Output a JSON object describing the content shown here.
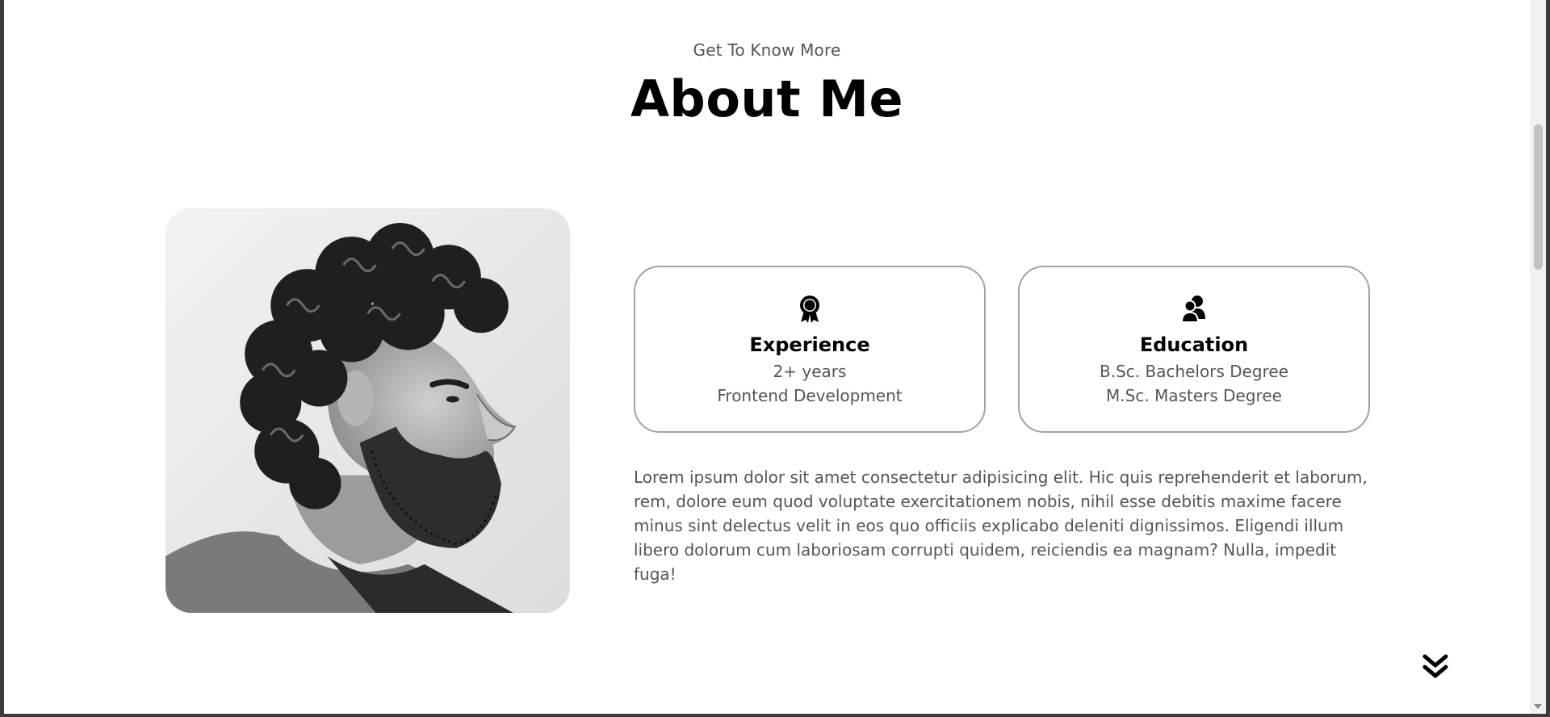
{
  "section": {
    "eyebrow": "Get To Know More",
    "title": "About Me"
  },
  "portrait": {
    "alt": "Profile picture"
  },
  "cards": [
    {
      "icon": "award-ribbon-icon",
      "heading": "Experience",
      "lines": [
        "2+ years",
        "Frontend Development"
      ]
    },
    {
      "icon": "users-icon",
      "heading": "Education",
      "lines": [
        "B.Sc. Bachelors Degree",
        "M.Sc. Masters Degree"
      ]
    }
  ],
  "bio": "Lorem ipsum dolor sit amet consectetur adipisicing elit. Hic quis reprehenderit et laborum, rem, dolore eum quod voluptate exercitationem nobis, nihil esse debitis maxime facere minus sint delectus velit in eos quo officiis explicabo deleniti dignissimos. Eligendi illum libero dolorum cum laboriosam corrupti quidem, reiciendis ea magnam? Nulla, impedit fuga!",
  "nav": {
    "scroll_icon": "chevrons-down-icon"
  },
  "colors": {
    "heading": "#000000",
    "body_text": "#555555",
    "card_border": "#a3a3a3"
  }
}
